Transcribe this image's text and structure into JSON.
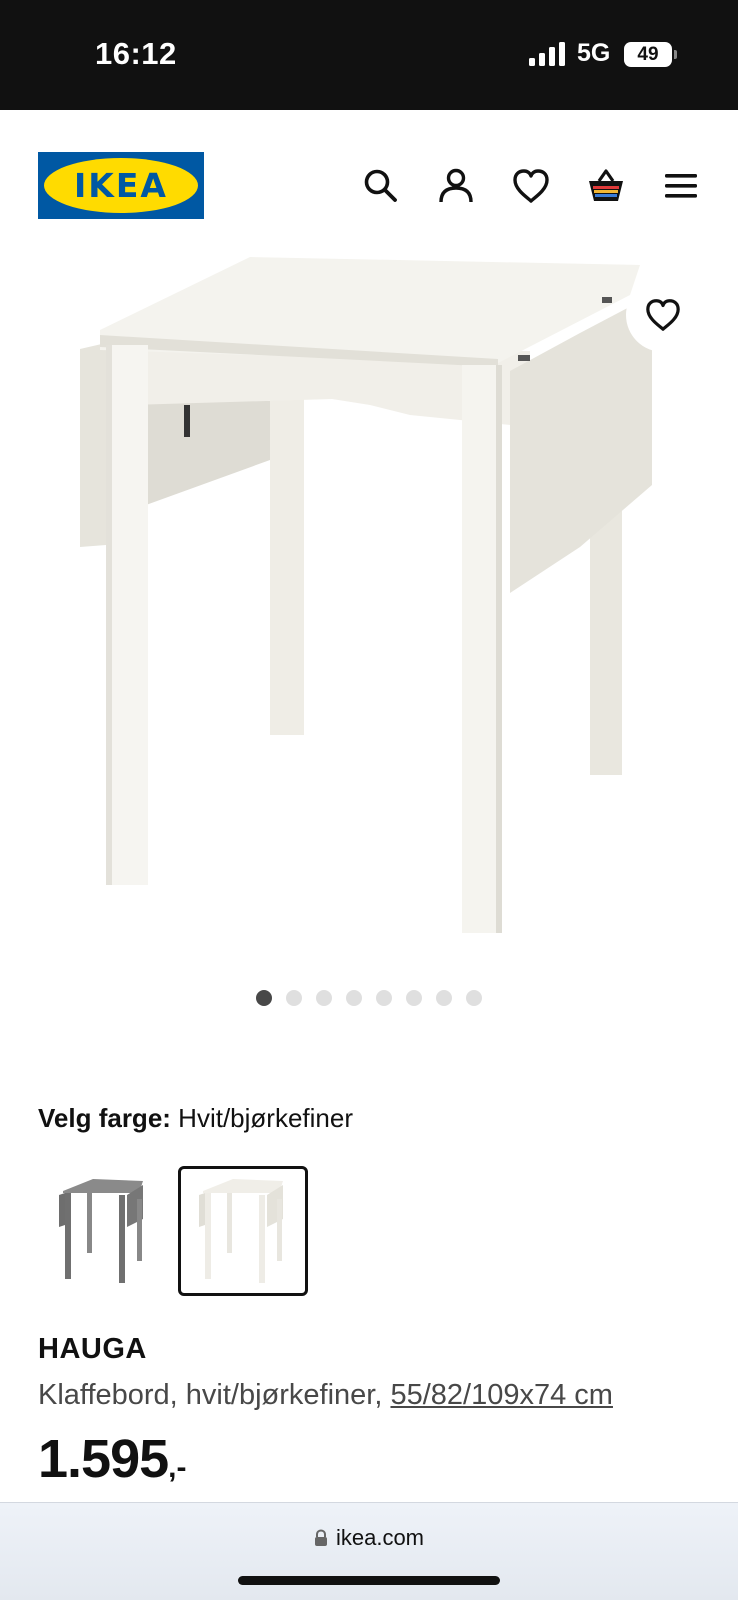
{
  "status_bar": {
    "time": "16:12",
    "network": "5G",
    "battery": "49"
  },
  "header": {
    "logo_text": "IKEA",
    "icons": [
      "search-icon",
      "account-icon",
      "favourites-icon",
      "basket-icon",
      "menu-icon"
    ]
  },
  "gallery": {
    "image_count": 8,
    "active_index": 0,
    "favourite_icon": "heart-icon"
  },
  "color_selection": {
    "label": "Velg farge:",
    "selected_value": "Hvit/bjørkefiner",
    "options": [
      {
        "color": "#7a7a7a",
        "selected": false
      },
      {
        "color": "#f3f1ea",
        "selected": true
      }
    ]
  },
  "product": {
    "name": "HAUGA",
    "description": "Klaffebord, hvit/bjørkefiner, ",
    "dimensions": "55/82/109x74 cm",
    "price": "1.595",
    "price_suffix": ",-"
  },
  "browser": {
    "url": "ikea.com"
  },
  "colors": {
    "ikea_blue": "#0058a3",
    "ikea_yellow": "#ffdb00"
  }
}
